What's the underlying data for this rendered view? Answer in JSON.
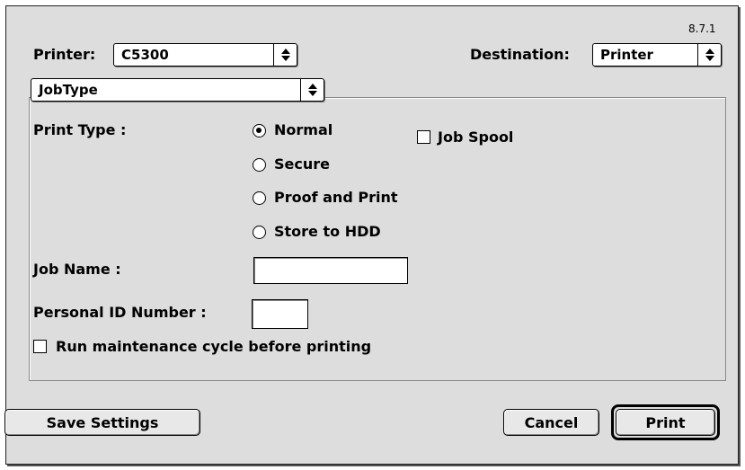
{
  "version": "8.7.1",
  "printer": {
    "label": "Printer:",
    "value": "C5300"
  },
  "destination": {
    "label": "Destination:",
    "value": "Printer"
  },
  "panel_selector": {
    "value": "JobType"
  },
  "print_type": {
    "label": "Print Type :",
    "options": [
      {
        "label": "Normal",
        "selected": true
      },
      {
        "label": "Secure",
        "selected": false
      },
      {
        "label": "Proof and Print",
        "selected": false
      },
      {
        "label": "Store to HDD",
        "selected": false
      }
    ]
  },
  "job_spool": {
    "label": "Job Spool",
    "checked": false
  },
  "job_name": {
    "label": "Job Name :",
    "value": ""
  },
  "personal_id": {
    "label": "Personal ID Number :",
    "value": ""
  },
  "maintenance": {
    "label": "Run maintenance cycle before printing",
    "checked": false
  },
  "buttons": {
    "save": "Save Settings",
    "cancel": "Cancel",
    "print": "Print"
  }
}
